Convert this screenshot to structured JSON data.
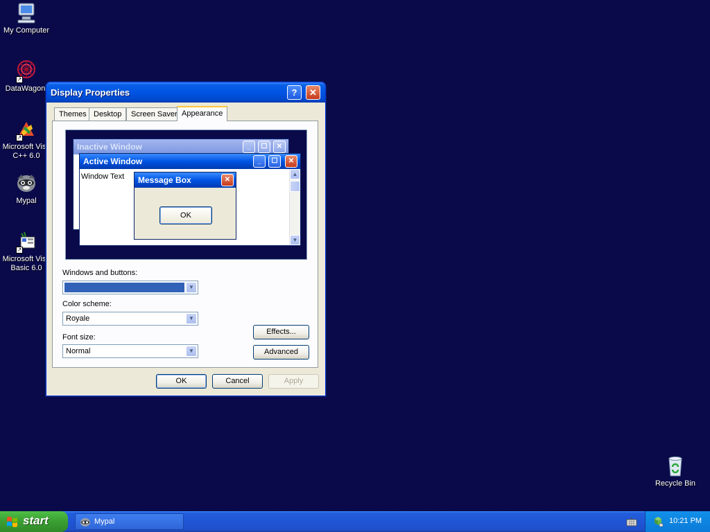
{
  "desktop": {
    "icons": [
      {
        "label": "My Computer",
        "icon": "computer-icon"
      },
      {
        "label": "DataWagon.",
        "icon": "datawagon-icon"
      },
      {
        "label": "Microsoft Visu\nC++ 6.0",
        "icon": "visual-cpp-icon",
        "line1": "Microsoft Visu",
        "line2": "C++ 6.0"
      },
      {
        "label": "Mypal",
        "icon": "mypal-icon"
      },
      {
        "label": "Microsoft Visu\nBasic 6.0",
        "icon": "visual-basic-icon",
        "line1": "Microsoft Visu",
        "line2": "Basic 6.0"
      },
      {
        "label": "Recycle Bin",
        "icon": "recycle-bin-icon"
      }
    ]
  },
  "dialog": {
    "title": "Display Properties",
    "help_glyph": "?",
    "close_glyph": "✕",
    "tabs": [
      {
        "label": "Themes",
        "active": false
      },
      {
        "label": "Desktop",
        "active": false
      },
      {
        "label": "Screen Saver",
        "active": false
      },
      {
        "label": "Appearance",
        "active": true
      }
    ],
    "preview": {
      "inactive_title": "Inactive Window",
      "active_title": "Active Window",
      "window_text": "Window Text",
      "message_box_title": "Message Box",
      "message_box_ok": "OK"
    },
    "windows_and_buttons": {
      "label": "Windows and buttons:",
      "value": "",
      "swatch_color": "#3162b8"
    },
    "color_scheme": {
      "label": "Color scheme:",
      "value": "Royale"
    },
    "font_size": {
      "label": "Font size:",
      "value": "Normal"
    },
    "effects_button": "Effects...",
    "advanced_button": "Advanced",
    "ok_button": "OK",
    "cancel_button": "Cancel",
    "apply_button": "Apply"
  },
  "taskbar": {
    "start_label": "start",
    "task_button": "Mypal",
    "clock": "10:21 PM"
  },
  "colors": {
    "desktop_bg": "#0a0a4a",
    "titlebar_blue": "#0054e3",
    "taskbar_blue": "#245edb",
    "start_green": "#3a9e32",
    "tray_blue": "#0a7ad8"
  }
}
